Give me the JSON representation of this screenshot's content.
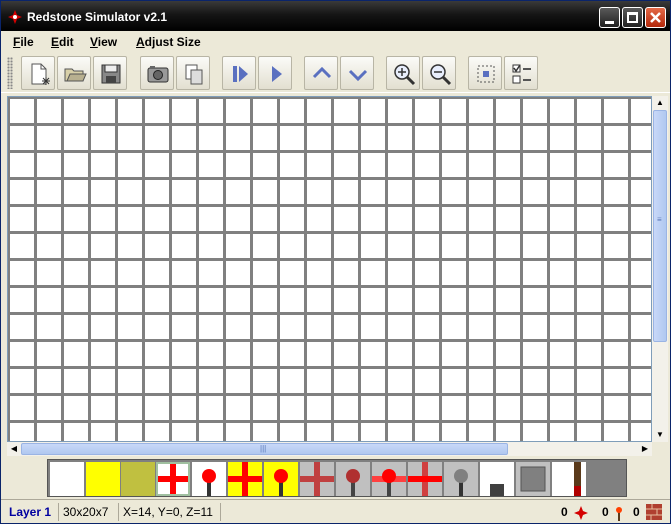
{
  "window": {
    "title": "Redstone Simulator v2.1"
  },
  "menu": {
    "items": [
      "File",
      "Edit",
      "View",
      "Adjust Size"
    ]
  },
  "toolbar": {
    "buttons": [
      "new-file",
      "open-folder",
      "save",
      "screenshot",
      "copy",
      "step-forward",
      "play",
      "layer-up",
      "layer-down",
      "zoom-in",
      "zoom-out",
      "fit-view",
      "options"
    ]
  },
  "palette": {
    "items": [
      "air",
      "wire-off",
      "block-off",
      "wire-cross",
      "torch-on",
      "wire-cross-on",
      "torch-yellow",
      "wire-cross-dim",
      "torch-dim",
      "torch-red-cross",
      "wire-cross-red",
      "button",
      "lever-gray",
      "block-gray",
      "door"
    ]
  },
  "status": {
    "layer": "Layer 1",
    "size": "30x20x7",
    "coords": "X=14, Y=0, Z=11",
    "count1": "0",
    "count2": "0",
    "count3": "0"
  },
  "colors": {
    "accent": "#ff0000",
    "wire": "#ffff00",
    "title_bg": "#000000"
  }
}
